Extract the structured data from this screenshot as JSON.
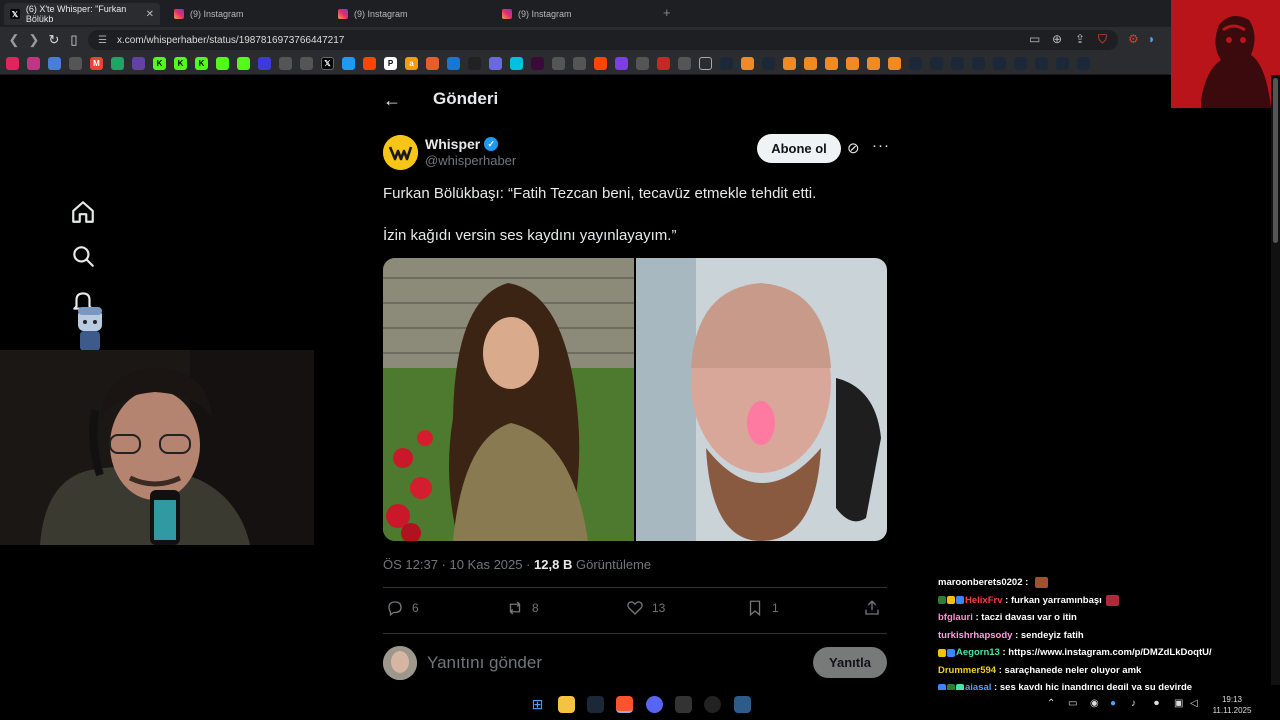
{
  "browser": {
    "tabs": [
      {
        "label": "(6) X'te Whisper: \"Furkan Bölükb",
        "icon": "x-icon",
        "active": true
      },
      {
        "label": "(9) Instagram",
        "icon": "instagram-icon",
        "active": false
      },
      {
        "label": "(9) Instagram",
        "icon": "instagram-icon",
        "active": false
      },
      {
        "label": "(9) Instagram",
        "icon": "instagram-icon",
        "active": false
      }
    ],
    "url": "x.com/whisperhaber/status/1987816973766447217"
  },
  "page": {
    "header_title": "Gönderi"
  },
  "tweet": {
    "display_name": "Whisper",
    "handle": "@whisperhaber",
    "subscribe_label": "Abone ol",
    "text_line1": "Furkan Bölükbaşı: “Fatih Tezcan beni, tecavüz etmekle tehdit etti.",
    "text_line2": "İzin kağıdı versin ses kaydını yayınlayayım.”",
    "time": "ÖS 12:37 · 10 Kas 2025 · ",
    "views": "12,8 B",
    "views_label": " Görüntüleme",
    "replies": "6",
    "reposts": "8",
    "likes": "13",
    "bookmarks": "1"
  },
  "reply": {
    "placeholder": "Yanıtını gönder",
    "button_label": "Yanıtla"
  },
  "chat": [
    {
      "user": "maroonberets0202",
      "user_color": "#ffffff",
      "message": "",
      "badges": [],
      "emote": true
    },
    {
      "user": "HelixFrv",
      "user_color": "#ff3b3b",
      "message": "furkan yarramınbaşı",
      "badges": [
        "#2e7d32",
        "#f4c20d",
        "#3a86ff"
      ],
      "emote": true
    },
    {
      "user": "bfglauri",
      "user_color": "#ff8fd1",
      "message": "taczi davası var o itin",
      "badges": [],
      "emote": false
    },
    {
      "user": "turkishrhapsody",
      "user_color": "#ff9ee3",
      "message": "sendeyiz fatih",
      "badges": [],
      "emote": false
    },
    {
      "user": "Aegorn13",
      "user_color": "#4be3a5",
      "message": "https://www.instagram.com/p/DMZdLkDoqtU/",
      "badges": [
        "#f4c20d",
        "#3a86ff"
      ],
      "emote": false
    },
    {
      "user": "Drummer594",
      "user_color": "#f0d020",
      "message": "saraçhanede neler oluyor amk",
      "badges": [],
      "emote": false
    },
    {
      "user": "ajasal",
      "user_color": "#4aa3ff",
      "message": "ses kaydı hiç inandırıcı degil ya şu devirde",
      "badges": [
        "#3a86ff",
        "#2e7d32",
        "#4be3a5"
      ],
      "emote": false
    }
  ],
  "clock": {
    "time": "19:13",
    "date": "11.11.2025"
  },
  "colors": {
    "accent": "#1d9bf0",
    "avatar_yellow": "#f6c518",
    "background": "#000000"
  }
}
